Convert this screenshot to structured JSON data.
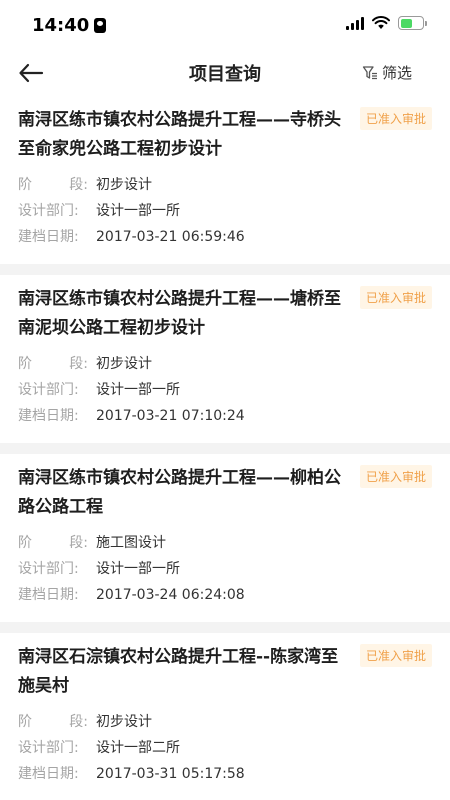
{
  "status_bar": {
    "time": "14:40"
  },
  "nav": {
    "title": "项目查询",
    "filter_label": "筛选"
  },
  "labels": {
    "stage_char1": "阶",
    "stage_char2": "段:",
    "department": "设计部门:",
    "created": "建档日期:"
  },
  "projects": [
    {
      "title": "南浔区练市镇农村公路提升工程——寺桥头至俞家兜公路工程初步设计",
      "badge": "已准入审批",
      "stage": "初步设计",
      "department": "设计一部一所",
      "created": "2017-03-21 06:59:46"
    },
    {
      "title": "南浔区练市镇农村公路提升工程——塘桥至南泥坝公路工程初步设计",
      "badge": "已准入审批",
      "stage": "初步设计",
      "department": "设计一部一所",
      "created": "2017-03-21 07:10:24"
    },
    {
      "title": "南浔区练市镇农村公路提升工程——柳柏公路公路工程",
      "badge": "已准入审批",
      "stage": "施工图设计",
      "department": "设计一部一所",
      "created": "2017-03-24 06:24:08"
    },
    {
      "title": "南浔区石淙镇农村公路提升工程--陈家湾至施吴村",
      "badge": "已准入审批",
      "stage": "初步设计",
      "department": "设计一部二所",
      "created": "2017-03-31 05:17:58"
    }
  ],
  "colors": {
    "badge_bg": "#fff5e6",
    "badge_text": "#f0a14a",
    "battery": "#4cd964"
  },
  "icons": {
    "back": "arrow-left-icon",
    "filter": "filter-icon",
    "wifi": "wifi-icon",
    "signal": "cellular-signal-icon",
    "battery": "battery-icon"
  },
  "battery_level": 0.55
}
